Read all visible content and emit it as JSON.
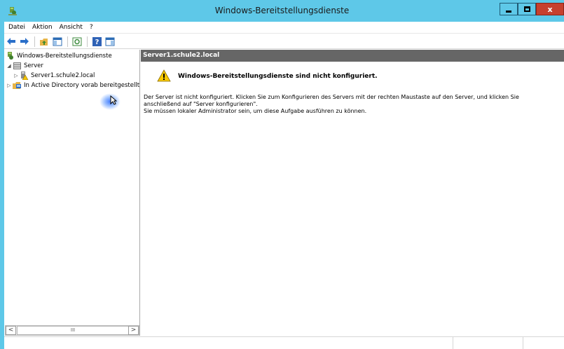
{
  "window": {
    "title": "Windows-Bereitstellungsdienste",
    "close_glyph": "x"
  },
  "menu": [
    "Datei",
    "Aktion",
    "Ansicht",
    "?"
  ],
  "tree": {
    "root": "Windows-Bereitstellungsdienste",
    "server_group": "Server",
    "server_item": "Server1.schule2.local",
    "ad_item": "In Active Directory vorab bereitgestellt",
    "scroll_thumb": "III",
    "scroll_left": "<",
    "scroll_right": ">"
  },
  "pane": {
    "header": "Server1.schule2.local",
    "warning_title": "Windows-Bereitstellungsdienste sind nicht konfiguriert.",
    "line1": "Der Server ist nicht konfiguriert. Klicken Sie zum Konfigurieren des Servers mit der rechten Maustaste auf den Server, und klicken Sie",
    "line2": "anschließend auf \"Server konfigurieren\".",
    "line3": "Sie müssen lokaler Administrator sein, um diese Aufgabe ausführen zu können."
  },
  "colors": {
    "titlebar": "#5ec8e8",
    "header": "#666666",
    "close": "#c7402e"
  }
}
